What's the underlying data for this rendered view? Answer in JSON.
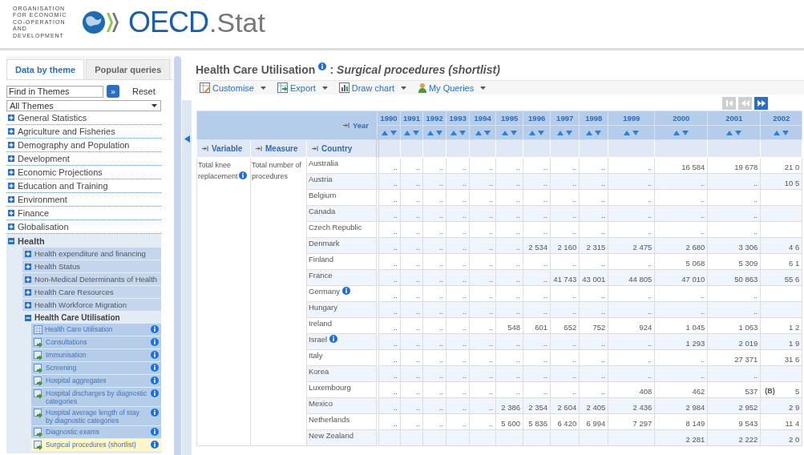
{
  "logo": {
    "org_lines": [
      "ORGANISATION",
      "FOR ECONOMIC",
      "CO-OPERATION",
      "AND DEVELOPMENT"
    ],
    "brand": "OECD",
    "suffix": ".Stat"
  },
  "sidebar": {
    "tabs": [
      {
        "label": "Data by theme",
        "selected": true
      },
      {
        "label": "Popular queries",
        "selected": false
      }
    ],
    "search": {
      "placeholder": "Find in Themes",
      "go": "»",
      "reset": "Reset"
    },
    "theme_select": {
      "value": "All Themes"
    },
    "themes": [
      {
        "label": "General Statistics",
        "expanded": false
      },
      {
        "label": "Agriculture and Fisheries",
        "expanded": false
      },
      {
        "label": "Demography and Population",
        "expanded": false
      },
      {
        "label": "Development",
        "expanded": false
      },
      {
        "label": "Economic Projections",
        "expanded": false
      },
      {
        "label": "Education and Training",
        "expanded": false
      },
      {
        "label": "Environment",
        "expanded": false
      },
      {
        "label": "Finance",
        "expanded": false
      },
      {
        "label": "Globalisation",
        "expanded": false
      },
      {
        "label": "Health",
        "expanded": true,
        "children": [
          {
            "label": "Health expenditure and financing",
            "expanded": false
          },
          {
            "label": "Health Status",
            "expanded": false
          },
          {
            "label": "Non-Medical Determinants of Health",
            "expanded": false
          },
          {
            "label": "Health Care Resources",
            "expanded": false
          },
          {
            "label": "Health Workforce Migration",
            "expanded": false
          },
          {
            "label": "Health Care Utilisation",
            "expanded": true,
            "children": [
              {
                "label": "Health Care Utilisation",
                "kind": "table",
                "selected": false
              },
              {
                "label": "Consultations",
                "kind": "dataset",
                "selected": false
              },
              {
                "label": "Immunisation",
                "kind": "dataset",
                "selected": false
              },
              {
                "label": "Screening",
                "kind": "dataset",
                "selected": false
              },
              {
                "label": "Hospital aggregates",
                "kind": "dataset",
                "selected": false
              },
              {
                "label": "Hospital discharges by diagnostic categories",
                "kind": "dataset",
                "selected": false
              },
              {
                "label": "Hospital average length of stay by diagnostic categories",
                "kind": "dataset",
                "selected": false
              },
              {
                "label": "Diagnostic exams",
                "kind": "dataset",
                "selected": false
              },
              {
                "label": "Surgical procedures (shortlist)",
                "kind": "dataset",
                "selected": true
              }
            ]
          }
        ]
      }
    ]
  },
  "title": {
    "main": "Health Care Utilisation",
    "separator": ":",
    "sub": "Surgical procedures (shortlist)"
  },
  "toolbar": [
    {
      "label": "Customise",
      "kind": "customise"
    },
    {
      "label": "Export",
      "kind": "export"
    },
    {
      "label": "Draw chart",
      "kind": "chart"
    },
    {
      "label": "My Queries",
      "kind": "queries"
    }
  ],
  "pager": [
    {
      "kind": "first",
      "disabled": true
    },
    {
      "kind": "previous",
      "disabled": true
    },
    {
      "kind": "next",
      "disabled": false
    }
  ],
  "table": {
    "year_label": "Year",
    "years": [
      "1990",
      "1991",
      "1992",
      "1993",
      "1994",
      "1995",
      "1996",
      "1997",
      "1998",
      "1999",
      "2000",
      "2001",
      "2002"
    ],
    "row_headers": [
      "Variable",
      "Measure",
      "Country"
    ],
    "variable": "Total knee replacement",
    "variable_info": true,
    "measure": "Total number of procedures",
    "rows": [
      {
        "country": "Australia",
        "info": false,
        "values": [
          "..",
          "..",
          "..",
          "..",
          "..",
          "..",
          "..",
          "..",
          "..",
          "..",
          "16 584",
          "19 678",
          "21 0"
        ]
      },
      {
        "country": "Austria",
        "info": false,
        "values": [
          "..",
          "..",
          "..",
          "..",
          "..",
          "..",
          "..",
          "..",
          "..",
          "..",
          "..",
          "..",
          "10 5"
        ]
      },
      {
        "country": "Belgium",
        "info": false,
        "values": [
          "..",
          "..",
          "..",
          "..",
          "..",
          "..",
          "..",
          "..",
          "..",
          "..",
          "..",
          ".."
        ]
      },
      {
        "country": "Canada",
        "info": false,
        "values": [
          "..",
          "..",
          "..",
          "..",
          "..",
          "..",
          "..",
          "..",
          "..",
          "..",
          "..",
          ".."
        ]
      },
      {
        "country": "Czech Republic",
        "info": false,
        "values": [
          "..",
          "..",
          "..",
          "..",
          "..",
          "..",
          "..",
          "..",
          "..",
          "..",
          "..",
          ".."
        ]
      },
      {
        "country": "Denmark",
        "info": false,
        "values": [
          "..",
          "..",
          "..",
          "..",
          "..",
          "..",
          "2 534",
          "2 160",
          "2 315",
          "2 475",
          "2 680",
          "3 306",
          "4 6"
        ]
      },
      {
        "country": "Finland",
        "info": false,
        "values": [
          "..",
          "..",
          "..",
          "..",
          "..",
          "..",
          "..",
          "..",
          "..",
          "..",
          "5 068",
          "5 309",
          "6 1"
        ]
      },
      {
        "country": "France",
        "info": false,
        "values": [
          "..",
          "..",
          "..",
          "..",
          "..",
          "..",
          "..",
          "41 743",
          "43 001",
          "44 805",
          "47 010",
          "50 863",
          "55 6"
        ]
      },
      {
        "country": "Germany",
        "info": true,
        "values": [
          "..",
          "..",
          "..",
          "..",
          "..",
          "..",
          "..",
          "..",
          "..",
          "..",
          "..",
          ".."
        ]
      },
      {
        "country": "Hungary",
        "info": false,
        "values": [
          "..",
          "..",
          "..",
          "..",
          "..",
          "..",
          "..",
          "..",
          "..",
          "..",
          "..",
          ".."
        ]
      },
      {
        "country": "Ireland",
        "info": false,
        "values": [
          "..",
          "..",
          "..",
          "..",
          "..",
          "548",
          "601",
          "652",
          "752",
          "924",
          "1 045",
          "1 063",
          "1 2"
        ]
      },
      {
        "country": "Israel",
        "info": true,
        "values": [
          "..",
          "..",
          "..",
          "..",
          "..",
          "..",
          "..",
          "..",
          "..",
          "..",
          "1 293",
          "2 019",
          "1 9"
        ]
      },
      {
        "country": "Italy",
        "info": false,
        "values": [
          "..",
          "..",
          "..",
          "..",
          "..",
          "..",
          "..",
          "..",
          "..",
          "..",
          "..",
          "27 371",
          "31 6"
        ]
      },
      {
        "country": "Korea",
        "info": false,
        "values": [
          "..",
          "..",
          "..",
          "..",
          "..",
          "..",
          "..",
          "..",
          "..",
          "..",
          "..",
          ".."
        ]
      },
      {
        "country": "Luxembourg",
        "info": false,
        "values": [
          "..",
          "..",
          "..",
          "..",
          "..",
          "..",
          "..",
          "..",
          "..",
          "408",
          "462",
          "537",
          {
            "flag": "(B)",
            "value": "5"
          }
        ]
      },
      {
        "country": "Mexico",
        "info": false,
        "values": [
          "..",
          "..",
          "..",
          "..",
          "..",
          "2 386",
          "2 354",
          "2 604",
          "2 405",
          "2 436",
          "2 984",
          "2 952",
          "2 9"
        ]
      },
      {
        "country": "Netherlands",
        "info": false,
        "values": [
          "..",
          "..",
          "..",
          "..",
          "..",
          "5 600",
          "5 836",
          "6 420",
          "6 994",
          "7 297",
          "8 149",
          "9 543",
          "11 4"
        ]
      },
      {
        "country": "New Zealand",
        "info": false,
        "values": {
          "2000": "2 281",
          "2001": "2 222",
          "2002": "2 0"
        }
      }
    ]
  }
}
